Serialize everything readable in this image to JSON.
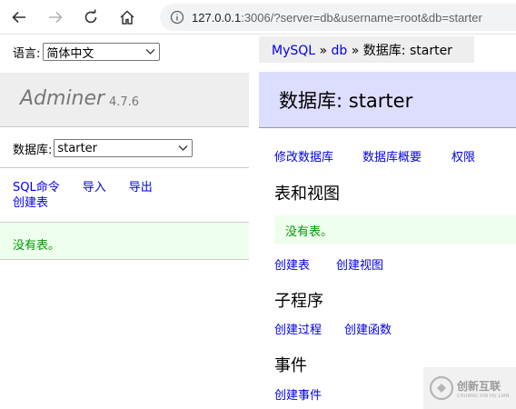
{
  "browser": {
    "url_host": "127.0.0.1",
    "url_rest": ":3006/?server=db&username=root&db=starter",
    "icons": [
      "back-icon",
      "forward-icon",
      "reload-icon",
      "home-icon",
      "info-icon"
    ]
  },
  "sidebar": {
    "lang_label": "语言:",
    "lang_value": "简体中文",
    "app_name": "Adminer",
    "app_version": "4.7.6",
    "db_label": "数据库:",
    "db_value": "starter",
    "links": {
      "sql": "SQL命令",
      "import": "导入",
      "export": "导出",
      "create_table": "创建表"
    },
    "no_tables": "没有表。"
  },
  "breadcrumb": {
    "server": "MySQL",
    "sep1": " » ",
    "db": "db",
    "sep2": " » ",
    "current": "数据库: starter"
  },
  "main": {
    "title": "数据库: starter",
    "actions": {
      "alter_db": "修改数据库",
      "db_schema": "数据库概要",
      "privileges": "权限"
    },
    "tables_heading": "表和视图",
    "no_tables": "没有表。",
    "create_table": "创建表",
    "create_view": "创建视图",
    "routines_heading": "子程序",
    "create_procedure": "创建过程",
    "create_function": "创建函数",
    "events_heading": "事件",
    "create_event": "创建事件"
  },
  "watermark": {
    "text_cn": "创新互联",
    "text_en": "CHUANG XIN HU LIAN"
  },
  "colors": {
    "link": "#0000ee",
    "success_bg": "#eeffee",
    "success_text": "#009900",
    "heading_bg": "#ddddff",
    "panel_bg": "#eeeeee"
  }
}
